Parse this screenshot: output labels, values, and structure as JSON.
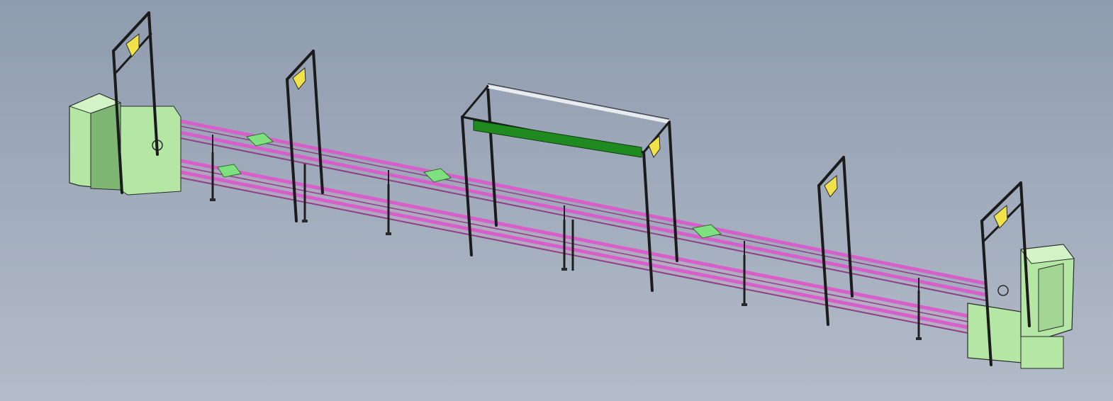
{
  "scene": {
    "subject": "double-deck-conveyor-line",
    "background": {
      "top": "#8f9caf",
      "bottom": "#b3bcc9"
    },
    "colors": {
      "rail": "#d65fc9",
      "rail_dark": "#8e3f86",
      "frame": "#1e1e1e",
      "cabinet": "#b4e6a4",
      "cabinet_dark": "#7fb673",
      "pallet": "#7fe07f",
      "sensor": "#f2e24a",
      "green_panel": "#1f8a1f",
      "white_bar": "#e9ecef"
    },
    "components": {
      "drive_cabinets": 2,
      "overhead_gantries": 5,
      "sensor_brackets": 5,
      "pallets_visible": 4,
      "conveyor_levels": 2
    }
  }
}
